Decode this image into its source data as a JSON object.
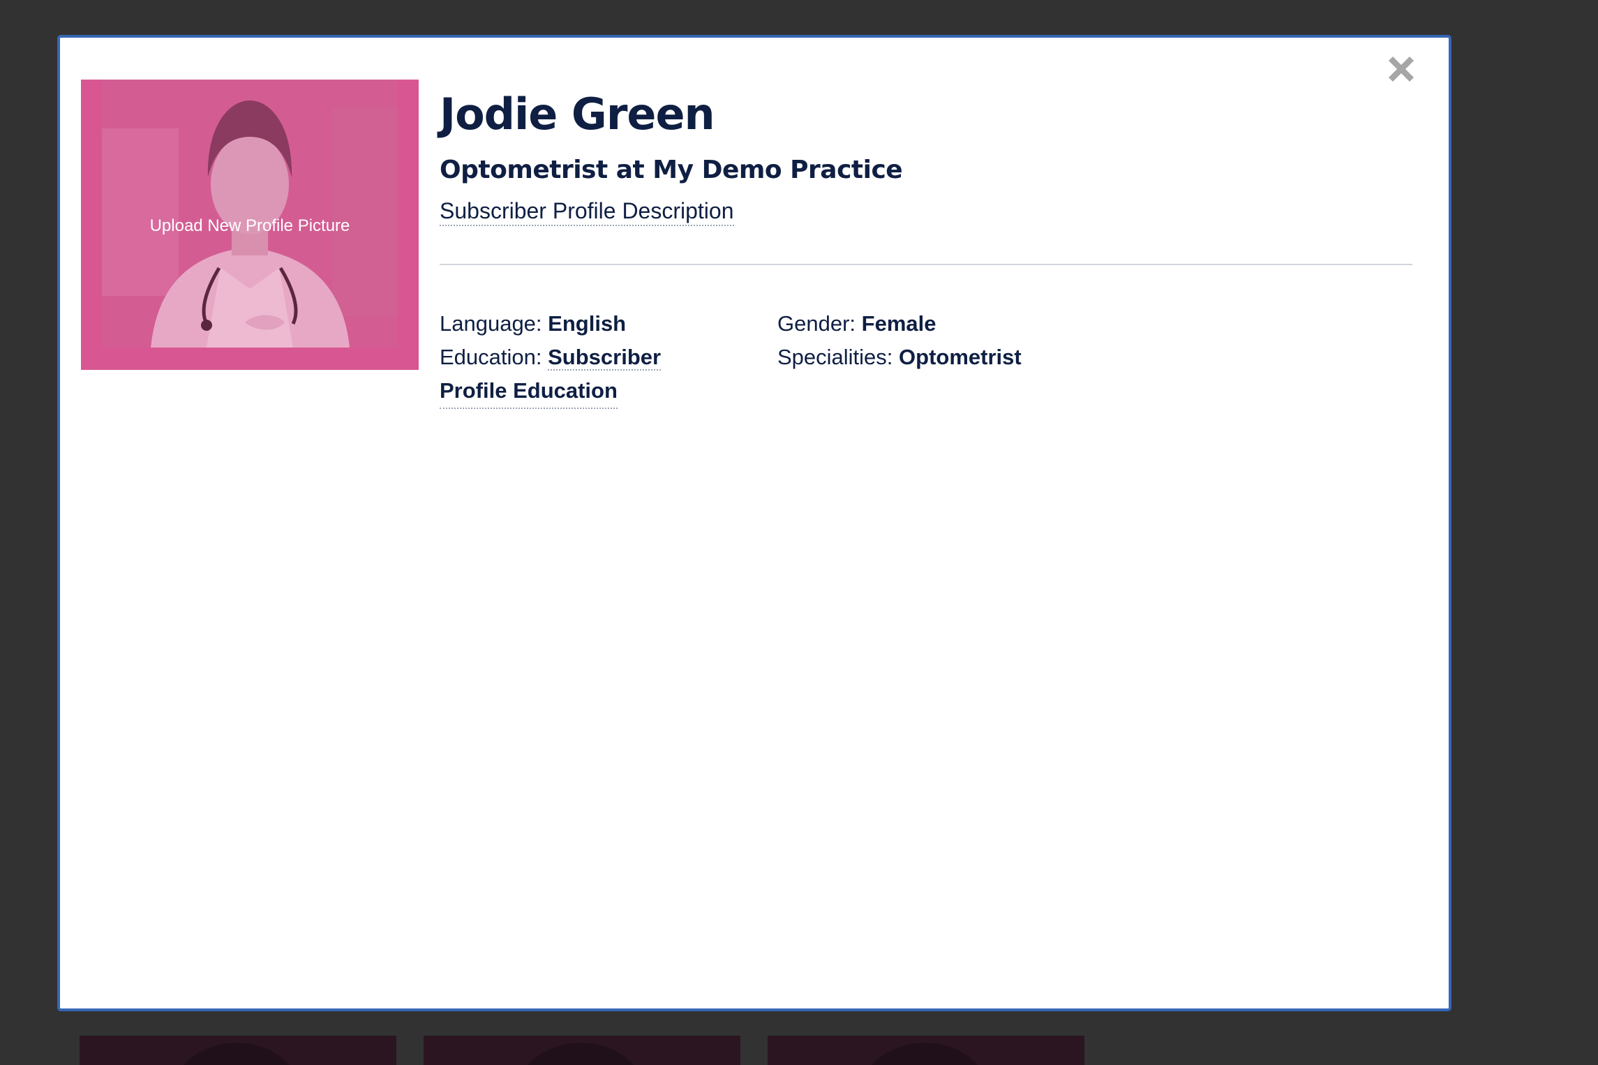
{
  "profile": {
    "name": "Jodie Green",
    "role": "Optometrist at My Demo Practice",
    "description": "Subscriber Profile Description",
    "upload_label": "Upload New Profile Picture"
  },
  "details": {
    "language_label": "Language:",
    "language_value": "English",
    "education_label": "Education:",
    "education_value_line1": "Subscriber",
    "education_value_line2": "Profile Education",
    "gender_label": "Gender:",
    "gender_value": "Female",
    "specialities_label": "Specialities:",
    "specialities_value": "Optometrist"
  },
  "colors": {
    "accent_border": "#3567b5",
    "avatar_overlay": "#d85793",
    "text": "#0f1f43",
    "backdrop": "#323232"
  },
  "icons": {
    "close": "close-icon"
  }
}
